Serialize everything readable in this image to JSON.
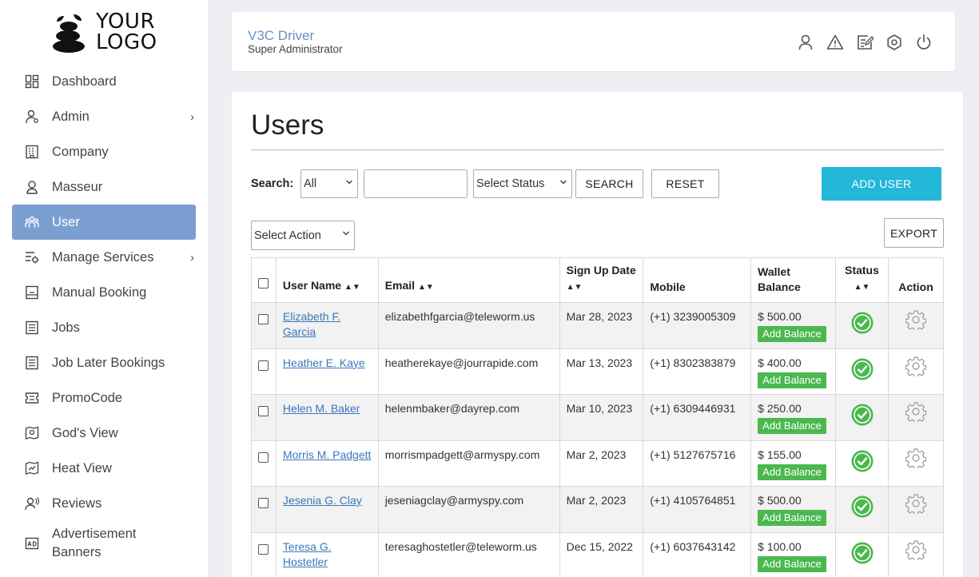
{
  "logo": {
    "line1": "YOUR",
    "line2": "LOGO"
  },
  "sidebar": {
    "items": [
      {
        "label": "Dashboard",
        "icon": "dashboard-icon"
      },
      {
        "label": "Admin",
        "icon": "admin-icon",
        "has_children": true
      },
      {
        "label": "Company",
        "icon": "company-icon"
      },
      {
        "label": "Masseur",
        "icon": "masseur-icon"
      },
      {
        "label": "User",
        "icon": "users-icon",
        "active": true
      },
      {
        "label": "Manage Services",
        "icon": "services-icon",
        "has_children": true
      },
      {
        "label": "Manual Booking",
        "icon": "booking-icon"
      },
      {
        "label": "Jobs",
        "icon": "jobs-icon"
      },
      {
        "label": "Job Later Bookings",
        "icon": "later-bookings-icon"
      },
      {
        "label": "PromoCode",
        "icon": "promocode-icon"
      },
      {
        "label": "God's View",
        "icon": "gods-view-icon"
      },
      {
        "label": "Heat View",
        "icon": "heat-view-icon"
      },
      {
        "label": "Reviews",
        "icon": "reviews-icon"
      },
      {
        "label": "Advertisement Banners",
        "icon": "banners-icon"
      }
    ]
  },
  "header": {
    "title": "V3C Driver",
    "subtitle": "Super Administrator",
    "icons": [
      "profile-icon",
      "alert-icon",
      "edit-icon",
      "settings-icon",
      "power-icon"
    ]
  },
  "page": {
    "title": "Users",
    "search_label": "Search:",
    "filter_select": "All",
    "search_input_value": "",
    "status_select": "Select Status",
    "search_button": "SEARCH",
    "reset_button": "RESET",
    "add_user_button": "ADD USER",
    "action_select": "Select Action",
    "export_button": "EXPORT"
  },
  "table": {
    "headers": {
      "user_name": "User Name",
      "email": "Email",
      "sign_up_date": "Sign Up Date",
      "mobile": "Mobile",
      "wallet_balance": "Wallet Balance",
      "status": "Status",
      "action": "Action"
    },
    "add_balance_label": "Add Balance",
    "rows": [
      {
        "name": "Elizabeth F. Garcia",
        "email": "elizabethfgarcia@teleworm.us",
        "date": "Mar 28, 2023",
        "mobile": "(+1) 3239005309",
        "balance": "$ 500.00"
      },
      {
        "name": "Heather E. Kaye",
        "email": "heatherekaye@jourrapide.com",
        "date": "Mar 13, 2023",
        "mobile": "(+1) 8302383879",
        "balance": "$ 400.00"
      },
      {
        "name": "Helen M. Baker",
        "email": "helenmbaker@dayrep.com",
        "date": "Mar 10, 2023",
        "mobile": "(+1) 6309446931",
        "balance": "$ 250.00"
      },
      {
        "name": "Morris M. Padgett",
        "email": "morrismpadgett@armyspy.com",
        "date": "Mar 2, 2023",
        "mobile": "(+1) 5127675716",
        "balance": "$ 155.00"
      },
      {
        "name": "Jesenia G. Clay",
        "email": "jeseniagclay@armyspy.com",
        "date": "Mar 2, 2023",
        "mobile": "(+1) 4105764851",
        "balance": "$ 500.00"
      },
      {
        "name": "Teresa G. Hostetler",
        "email": "teresaghostetler@teleworm.us",
        "date": "Dec 15, 2022",
        "mobile": "(+1) 6037643142",
        "balance": "$ 100.00"
      }
    ]
  },
  "colors": {
    "sidebar_active": "#7c9fd1",
    "accent_button": "#23b7d9",
    "add_balance": "#4ab84f",
    "status_active": "#4ab84f",
    "link": "#3a77b9"
  }
}
